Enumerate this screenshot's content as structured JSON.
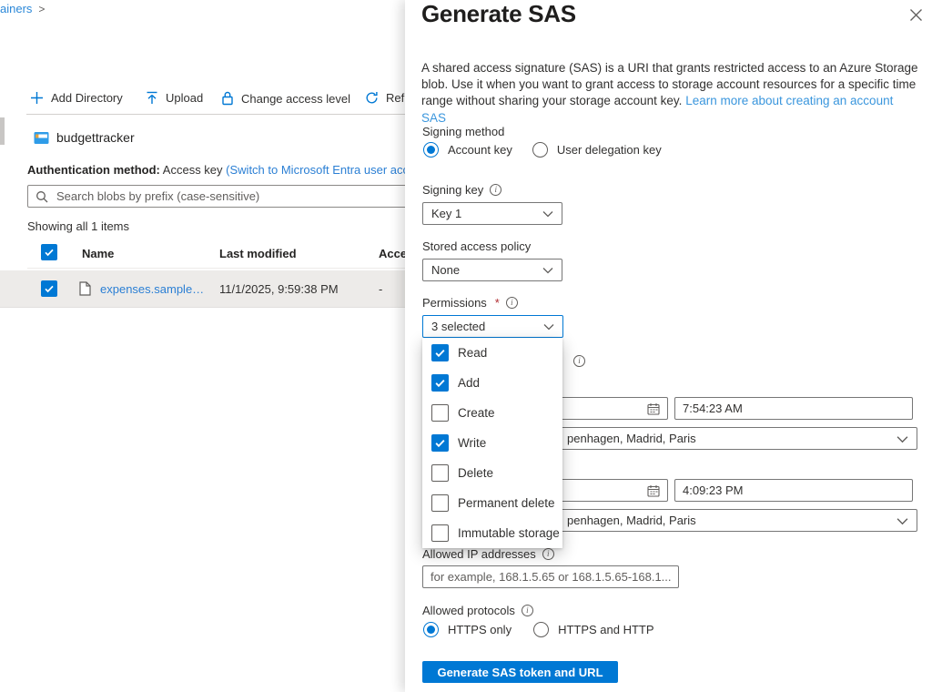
{
  "breadcrumb": {
    "trail": "ainers",
    "separator": ">"
  },
  "toolbar": {
    "items": [
      {
        "label": "Add Directory",
        "icon": "plus-icon"
      },
      {
        "label": "Upload",
        "icon": "upload-icon"
      },
      {
        "label": "Change access level",
        "icon": "lock-icon"
      },
      {
        "label": "Ref",
        "icon": "refresh-icon"
      }
    ]
  },
  "container": {
    "name": "budgettracker"
  },
  "auth": {
    "label": "Authentication method:",
    "value": "Access key",
    "switch_link": "(Switch to Microsoft Entra user acc"
  },
  "search": {
    "placeholder": "Search blobs by prefix (case-sensitive)"
  },
  "list": {
    "summary": "Showing all 1 items",
    "columns": {
      "name": "Name",
      "last_modified": "Last modified",
      "access": "Acce"
    },
    "rows": [
      {
        "name": "expenses.sample…",
        "last_modified": "11/1/2025, 9:59:38 PM",
        "access": "-"
      }
    ]
  },
  "panel": {
    "title": "Generate SAS",
    "description": "A shared access signature (SAS) is a URI that grants restricted access to an Azure Storage blob. Use it when you want to grant access to storage account resources for a specific time range without sharing your storage account key.",
    "learn_more": "Learn more about creating an account SAS",
    "signing_method": {
      "label": "Signing method",
      "options": [
        {
          "label": "Account key",
          "selected": true
        },
        {
          "label": "User delegation key",
          "selected": false
        }
      ]
    },
    "signing_key": {
      "label": "Signing key",
      "value": "Key 1"
    },
    "stored_policy": {
      "label": "Stored access policy",
      "value": "None"
    },
    "permissions": {
      "label": "Permissions",
      "required_mark": "*",
      "value": "3 selected",
      "options": [
        {
          "label": "Read",
          "checked": true
        },
        {
          "label": "Add",
          "checked": true
        },
        {
          "label": "Create",
          "checked": false
        },
        {
          "label": "Write",
          "checked": true
        },
        {
          "label": "Delete",
          "checked": false
        },
        {
          "label": "Permanent delete",
          "checked": false
        },
        {
          "label": "Immutable storage",
          "checked": false
        }
      ]
    },
    "start": {
      "time": "7:54:23 AM",
      "timezone": "penhagen, Madrid, Paris"
    },
    "expiry": {
      "time": "4:09:23 PM",
      "timezone": "penhagen, Madrid, Paris"
    },
    "allowed_ip": {
      "label": "Allowed IP addresses",
      "placeholder": "for example, 168.1.5.65 or 168.1.5.65-168.1...."
    },
    "allowed_protocols": {
      "label": "Allowed protocols",
      "options": [
        {
          "label": "HTTPS only",
          "selected": true
        },
        {
          "label": "HTTPS and HTTP",
          "selected": false
        }
      ]
    },
    "generate_button": "Generate SAS token and URL"
  },
  "colors": {
    "accent": "#0078d4",
    "link": "#2b7fd4",
    "selected_row_bg": "#edebe9"
  }
}
